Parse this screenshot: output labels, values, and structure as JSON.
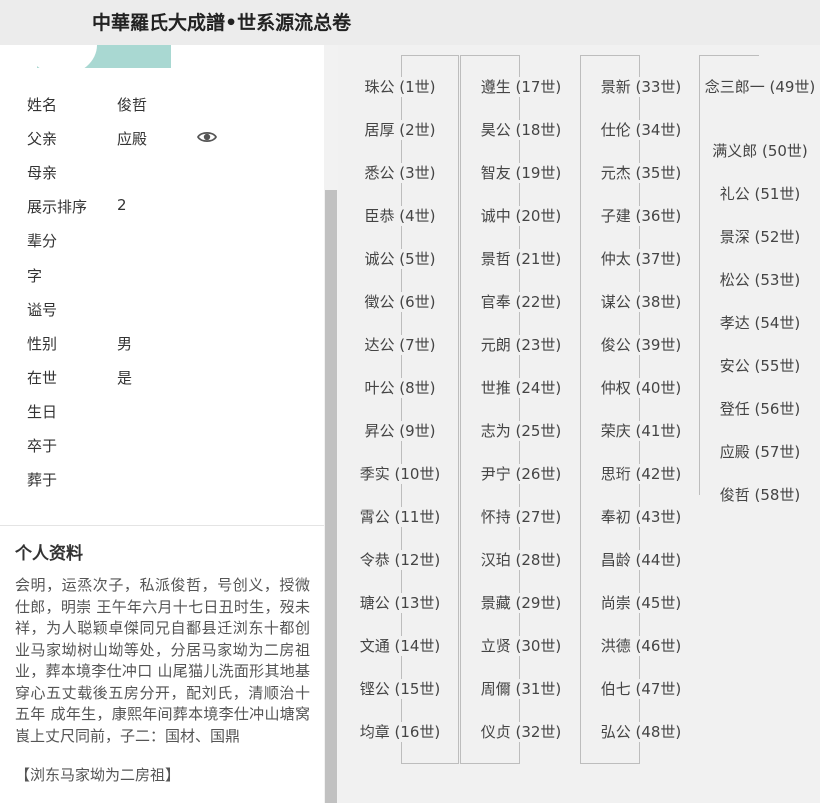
{
  "header": {
    "title": "中華羅氏大成譜•世系源流总卷"
  },
  "person": {
    "fields": [
      {
        "label": "姓名",
        "value": "俊哲"
      },
      {
        "label": "父亲",
        "value": "应殿"
      },
      {
        "label": "母亲",
        "value": ""
      },
      {
        "label": "展示排序",
        "value": "2"
      },
      {
        "label": "辈分",
        "value": ""
      },
      {
        "label": "字",
        "value": ""
      },
      {
        "label": "谥号",
        "value": ""
      },
      {
        "label": "性别",
        "value": "男"
      },
      {
        "label": "在世",
        "value": "是"
      },
      {
        "label": "生日",
        "value": ""
      },
      {
        "label": "卒于",
        "value": ""
      },
      {
        "label": "葬于",
        "value": ""
      }
    ]
  },
  "profile": {
    "title": "个人资料",
    "bio": "会明，运烝次子，私派俊哲，号创义，授微仕郎，明崇 王午年六月十七日丑时生，歿未祥，为人聪颖卓傑同兄自鄱县迁浏东十都创业马家坳树山坳等处，分居马家坳为二房祖业，葬本境李仕冲口 山尾猫儿洗面形其地基穿心五丈载後五房分开，配刘氏，清顺治十五年 成年生，康熙年间葬本境李仕冲山塘窝崀上丈尺同前，子二：国材、国鼎",
    "tag": "【浏东马家坳为二房祖】"
  },
  "icons": {
    "eye": "eye-icon"
  },
  "generations": [
    [
      "珠公 (1世)",
      "居厚 (2世)",
      "悉公 (3世)",
      "臣恭 (4世)",
      "诚公 (5世)",
      "徵公 (6世)",
      "达公 (7世)",
      "叶公 (8世)",
      "昇公 (9世)",
      "季实 (10世)",
      "霄公 (11世)",
      "令恭 (12世)",
      "瑭公 (13世)",
      "文通 (14世)",
      "铿公 (15世)",
      "均章 (16世)"
    ],
    [
      "遵生 (17世)",
      "昊公 (18世)",
      "智友 (19世)",
      "诚中 (20世)",
      "景哲 (21世)",
      "官奉 (22世)",
      "元朗 (23世)",
      "世推 (24世)",
      "志为 (25世)",
      "尹宁 (26世)",
      "怀持 (27世)",
      "汉珀 (28世)",
      "景藏 (29世)",
      "立贤 (30世)",
      "周儞 (31世)",
      "仪贞 (32世)"
    ],
    [
      "景新 (33世)",
      "仕伦 (34世)",
      "元杰 (35世)",
      "子建 (36世)",
      "仲太 (37世)",
      "谋公 (38世)",
      "俊公 (39世)",
      "仲权 (40世)",
      "荣庆 (41世)",
      "思珩 (42世)",
      "奉初 (43世)",
      "昌龄 (44世)",
      "尚崇 (45世)",
      "洪德 (46世)",
      "伯七 (47世)",
      "弘公 (48世)"
    ],
    [
      "念三郎一 (49世)",
      "满义郎 (50世)",
      "礼公 (51世)",
      "景深 (52世)",
      "松公 (53世)",
      "孝达 (54世)",
      "安公 (55世)",
      "登任 (56世)",
      "应殿 (57世)",
      "俊哲 (58世)"
    ]
  ]
}
